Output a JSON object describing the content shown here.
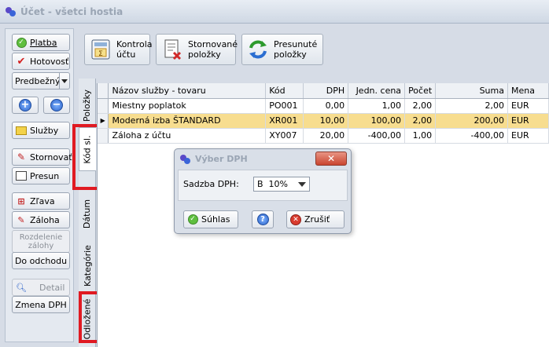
{
  "window": {
    "title": "Účet - všetci hostia"
  },
  "left_panel": {
    "platba": "Platba",
    "hotovost": "Hotovosť",
    "predbezny": "Predbežný",
    "sluzby": "Služby",
    "stornovat": "Stornovať",
    "presun": "Presun",
    "zlava": "Zľava",
    "zaloha": "Záloha",
    "rozdelenie_line1": "Rozdelenie",
    "rozdelenie_line2": "zálohy",
    "do_odchodu": "Do odchodu",
    "detail": "Detail",
    "zmena_dph": "Zmena DPH"
  },
  "toolbar": {
    "kontrola_line1": "Kontrola",
    "kontrola_line2": "účtu",
    "stornovane_line1": "Stornované",
    "stornovane_line2": "položky",
    "presunute_line1": "Presunuté",
    "presunute_line2": "položky"
  },
  "vertical_tabs": {
    "polozky": "Položky",
    "kod_sl": "Kód sl.",
    "datum": "Dátum",
    "kategorie": "Kategórie",
    "odlozene": "Odložené"
  },
  "table": {
    "columns": [
      "Názov služby - tovaru",
      "Kód",
      "DPH",
      "Jedn. cena",
      "Počet",
      "Suma",
      "Mena"
    ],
    "rows": [
      [
        "Miestny poplatok",
        "PO001",
        "0,00",
        "1,00",
        "2,00",
        "2,00",
        "EUR"
      ],
      [
        "Moderná izba ŠTANDARD",
        "XR001",
        "10,00",
        "100,00",
        "2,00",
        "200,00",
        "EUR"
      ],
      [
        "Záloha z účtu",
        "XY007",
        "20,00",
        "-400,00",
        "1,00",
        "-400,00",
        "EUR"
      ]
    ],
    "selected_row": 1
  },
  "dialog": {
    "title": "Výber DPH",
    "close": "✕",
    "label": "Sadzba DPH:",
    "value": "B  10%",
    "ok": "Súhlas",
    "help": "?",
    "cancel": "Zrušiť"
  },
  "colors": {
    "selected_row": "#f7dd8f",
    "highlight_box": "#e01a22"
  }
}
